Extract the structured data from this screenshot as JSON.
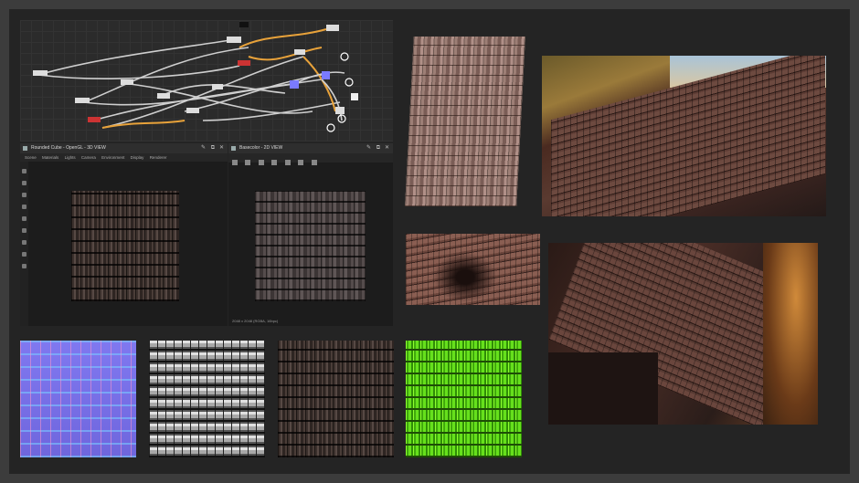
{
  "viewer3d": {
    "title": "Rounded Cube - OpenGL - 3D VIEW",
    "menu": [
      "Scene",
      "Materials",
      "Lights",
      "Camera",
      "Environment",
      "Display",
      "Renderer"
    ]
  },
  "viewer2d": {
    "title": "Basecolor - 2D VIEW",
    "footer": "2048 x 2048 (RGBA, 16bpc)"
  },
  "maps": [
    "normal",
    "height",
    "basecolor",
    "mask"
  ],
  "colors": {
    "background": "#242424",
    "frame": "#3c3c3c",
    "graph_bg": "#2b2b2b",
    "link_orange": "#e8a23a",
    "link_gray": "#cfcfcf"
  }
}
